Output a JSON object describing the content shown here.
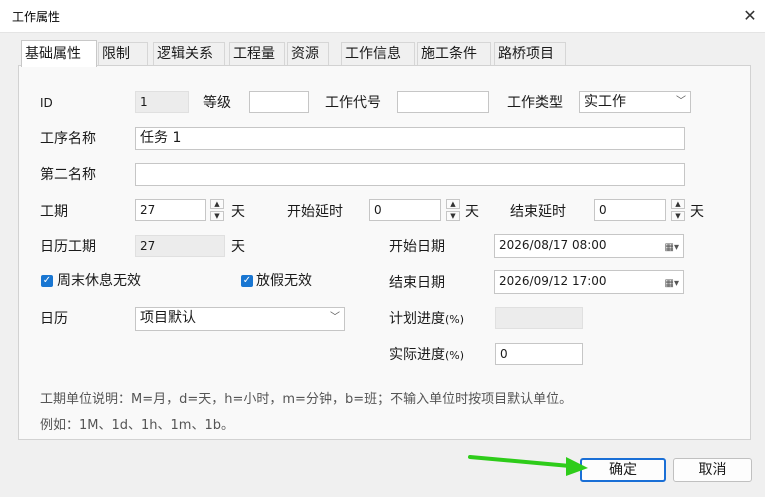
{
  "window": {
    "title": "工作属性",
    "close_icon": "close-icon"
  },
  "tabs": [
    {
      "label": "基础属性",
      "active": true
    },
    {
      "label": "限制"
    },
    {
      "label": "逻辑关系"
    },
    {
      "label": "工程量"
    },
    {
      "label": "资源"
    },
    {
      "label": "工作信息"
    },
    {
      "label": "施工条件"
    },
    {
      "label": "路桥项目"
    }
  ],
  "form": {
    "id_label": "ID",
    "id_value": "1",
    "grade_label": "等级",
    "grade_value": "",
    "code_label": "工作代号",
    "code_value": "",
    "type_label": "工作类型",
    "type_value": "实工作",
    "name_label": "工序名称",
    "name_value": "任务 1",
    "second_name_label": "第二名称",
    "second_name_value": "",
    "duration_label": "工期",
    "duration_value": "27",
    "duration_unit": "天",
    "start_delay_label": "开始延时",
    "start_delay_value": "0",
    "start_delay_unit": "天",
    "end_delay_label": "结束延时",
    "end_delay_value": "0",
    "end_delay_unit": "天",
    "calendar_duration_label": "日历工期",
    "calendar_duration_value": "27",
    "calendar_duration_unit": "天",
    "start_date_label": "开始日期",
    "start_date_value": "2026/08/17 08:00",
    "end_date_label": "结束日期",
    "end_date_value": "2026/09/12 17:00",
    "weekend_label": "周末休息无效",
    "weekend_checked": true,
    "holiday_label": "放假无效",
    "holiday_checked": true,
    "calendar_label": "日历",
    "calendar_value": "项目默认",
    "plan_progress_label": "计划进度",
    "plan_progress_unit": "(%)",
    "plan_progress_value": "",
    "actual_progress_label": "实际进度",
    "actual_progress_unit": "(%)",
    "actual_progress_value": "0",
    "note_line1": "工期单位说明：M=月，d=天，h=小时，m=分钟，b=班；不输入单位时按项目默认单位。",
    "note_line2": "例如：1M、1d、1h、1m、1b。"
  },
  "buttons": {
    "ok": "确定",
    "cancel": "取消"
  },
  "colors": {
    "checkbox": "#1976d2",
    "arrow": "#2ecc1a",
    "primary_border": "#1a6fd6"
  }
}
